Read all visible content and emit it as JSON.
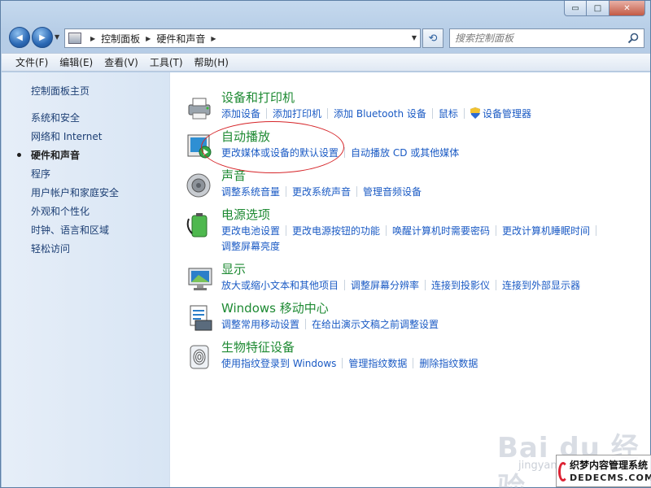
{
  "window": {
    "caption_minimize": "▭",
    "caption_maximize": "□",
    "caption_close": "✕"
  },
  "nav": {
    "back_glyph": "◀",
    "forward_glyph": "▶",
    "dropdown_glyph": "▼",
    "refresh_glyph": "⟲",
    "breadcrumb_sep": "▶",
    "breadcrumb": [
      "控制面板",
      "硬件和声音"
    ]
  },
  "search": {
    "placeholder": "搜索控制面板",
    "icon": "search-icon"
  },
  "menu": [
    "文件(F)",
    "编辑(E)",
    "查看(V)",
    "工具(T)",
    "帮助(H)"
  ],
  "sidebar": {
    "home": "控制面板主页",
    "items": [
      {
        "label": "系统和安全",
        "active": false
      },
      {
        "label": "网络和 Internet",
        "active": false
      },
      {
        "label": "硬件和声音",
        "active": true
      },
      {
        "label": "程序",
        "active": false
      },
      {
        "label": "用户帐户和家庭安全",
        "active": false
      },
      {
        "label": "外观和个性化",
        "active": false
      },
      {
        "label": "时钟、语言和区域",
        "active": false
      },
      {
        "label": "轻松访问",
        "active": false
      }
    ]
  },
  "categories": [
    {
      "title": "设备和打印机",
      "icon": "printer-icon",
      "links": [
        "添加设备",
        "添加打印机",
        "添加 Bluetooth 设备",
        "鼠标",
        "设备管理器"
      ]
    },
    {
      "title": "自动播放",
      "icon": "autoplay-icon",
      "links": [
        "更改媒体或设备的默认设置",
        "自动播放 CD 或其他媒体"
      ]
    },
    {
      "title": "声音",
      "icon": "speaker-icon",
      "links": [
        "调整系统音量",
        "更改系统声音",
        "管理音频设备"
      ]
    },
    {
      "title": "电源选项",
      "icon": "battery-icon",
      "links": [
        "更改电池设置",
        "更改电源按钮的功能",
        "唤醒计算机时需要密码",
        "更改计算机睡眠时间",
        "调整屏幕亮度"
      ]
    },
    {
      "title": "显示",
      "icon": "monitor-icon",
      "links": [
        "放大或缩小文本和其他项目",
        "调整屏幕分辨率",
        "连接到投影仪",
        "连接到外部显示器"
      ]
    },
    {
      "title": "Windows 移动中心",
      "icon": "mobility-center-icon",
      "links": [
        "调整常用移动设置",
        "在给出演示文稿之前调整设置"
      ]
    },
    {
      "title": "生物特征设备",
      "icon": "fingerprint-icon",
      "links": [
        "使用指纹登录到 Windows",
        "管理指纹数据",
        "删除指纹数据"
      ]
    }
  ],
  "watermark": {
    "brand": "Bai du 经验",
    "sub": "jingyan",
    "line1": "织梦内容管理系统",
    "line2": "DEDECMS.COM"
  },
  "colors": {
    "category_title": "#1e8a33",
    "link": "#1a5ac4",
    "annotation": "#d6262a"
  }
}
